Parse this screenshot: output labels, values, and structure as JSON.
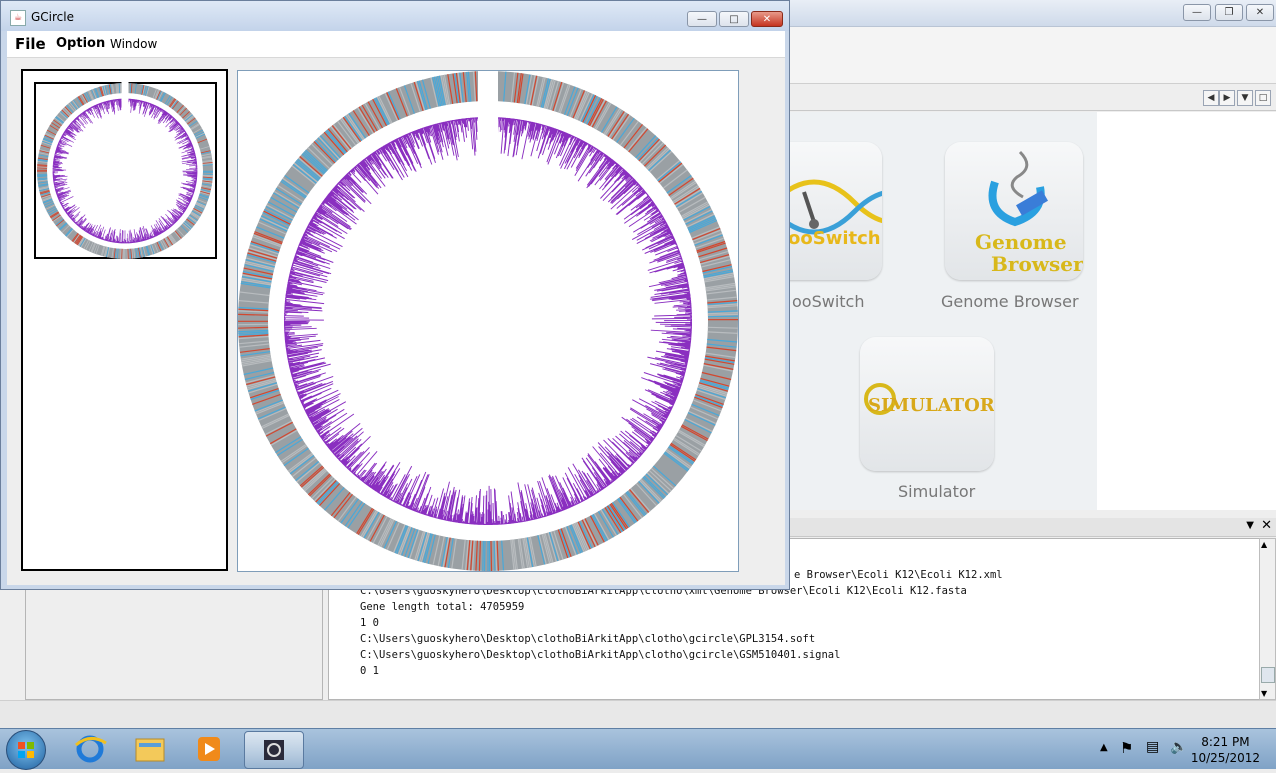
{
  "gcircle": {
    "title": "GCircle",
    "menu": [
      "File",
      "Option",
      "Window"
    ]
  },
  "background_app": {
    "apps": [
      {
        "name": "ooSwitch",
        "logo_text": "ooSwitch"
      },
      {
        "name": "Genome Browser",
        "logo_line1": "Genome",
        "logo_line2": "Browser"
      },
      {
        "name": "Simulator",
        "logo_text": "SIMULATOR"
      }
    ],
    "console_lines": [
      "e Browser\\Ecoli K12\\Ecoli K12.xml",
      "C:\\Users\\guoskyhero\\Desktop\\clothoBiArkitApp\\clotho\\xml\\Genome Browser\\Ecoli K12\\Ecoli K12.fasta",
      "Gene length total: 4705959",
      "1 0",
      "C:\\Users\\guoskyhero\\Desktop\\clothoBiArkitApp\\clotho\\gcircle\\GPL3154.soft",
      "C:\\Users\\guoskyhero\\Desktop\\clothoBiArkitApp\\clotho\\gcircle\\GSM510401.signal",
      "0 1"
    ]
  },
  "taskbar": {
    "time": "8:21 PM",
    "date": "10/25/2012"
  },
  "colors": {
    "ring_gray": "#9aa0a4",
    "ring_blue": "#4aa8d8",
    "ring_red": "#d2472f",
    "signal_purple": "#8a2fc0"
  }
}
